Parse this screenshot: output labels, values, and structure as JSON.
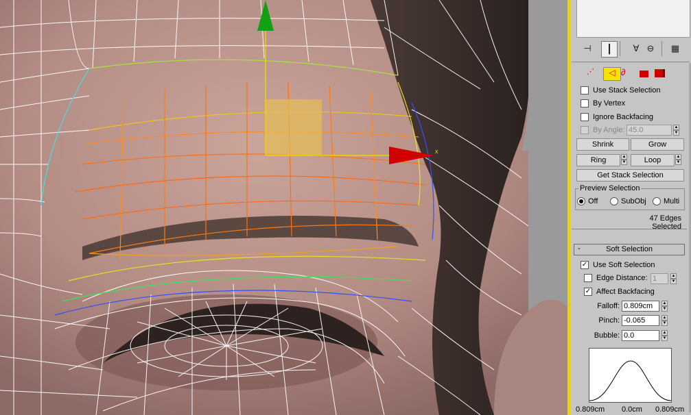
{
  "selection_panel": {
    "use_stack_selection": "Use Stack Selection",
    "by_vertex": "By Vertex",
    "ignore_backfacing": "Ignore Backfacing",
    "by_angle_label": "By Angle:",
    "by_angle_value": "45.0",
    "shrink": "Shrink",
    "grow": "Grow",
    "ring": "Ring",
    "loop": "Loop",
    "get_stack_selection": "Get Stack Selection",
    "preview_selection_title": "Preview Selection",
    "preview_off": "Off",
    "preview_subobj": "SubObj",
    "preview_multi": "Multi",
    "status": "47 Edges Selected"
  },
  "soft_selection": {
    "collapse_symbol": "-",
    "title": "Soft Selection",
    "use_soft_selection": "Use Soft Selection",
    "edge_distance_label": "Edge Distance:",
    "edge_distance_value": "1",
    "affect_backfacing": "Affect Backfacing",
    "falloff_label": "Falloff:",
    "falloff_value": "0.809cm",
    "pinch_label": "Pinch:",
    "pinch_value": "-0.065",
    "bubble_label": "Bubble:",
    "bubble_value": "0.0",
    "curve_left": "0.809cm",
    "curve_center": "0.0cm",
    "curve_right": "0.809cm"
  },
  "gizmo": {
    "x_axis_label": "x"
  },
  "colors": {
    "accent_yellow": "#e8d400",
    "panel_bg": "#c5c5c5",
    "gizmo_green": "#14a014",
    "gizmo_red": "#d00000"
  }
}
